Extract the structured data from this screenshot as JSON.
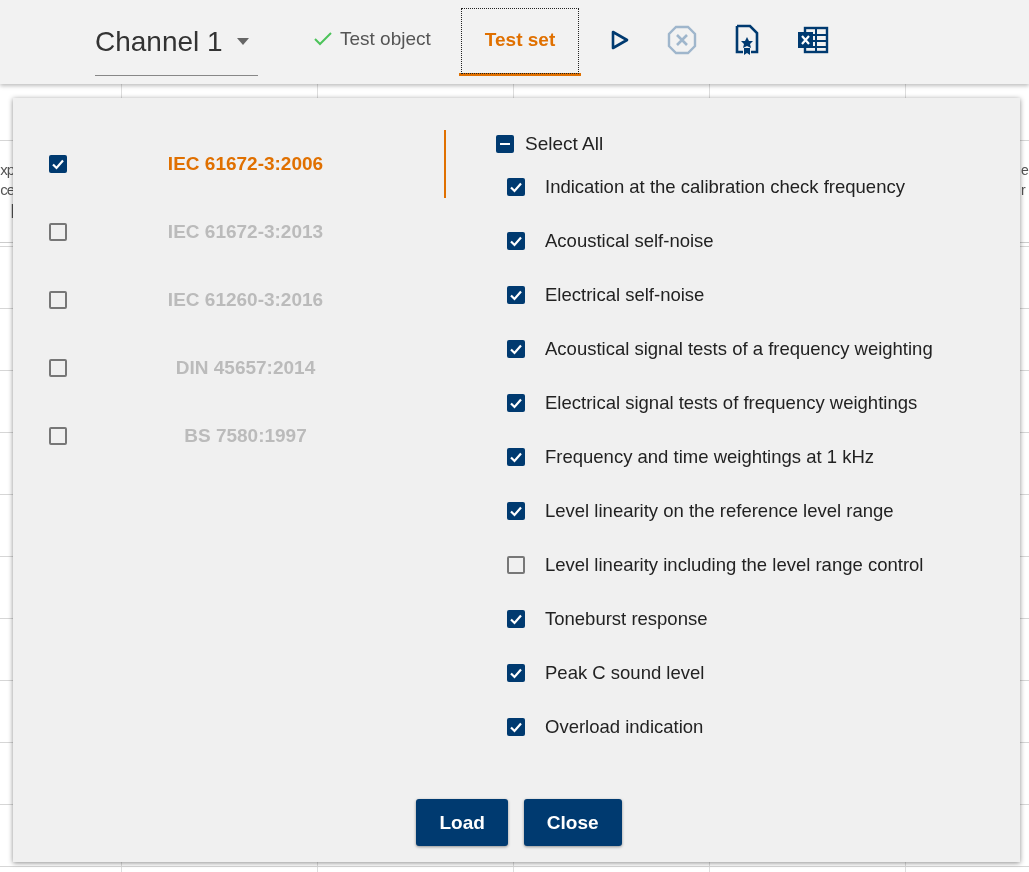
{
  "toolbar": {
    "channel": {
      "label": "Channel 1"
    },
    "tabs": [
      {
        "label": "Test object",
        "done": true,
        "selected": false
      },
      {
        "label": "Test set",
        "done": false,
        "selected": true
      }
    ],
    "actions": [
      {
        "kind": "play",
        "disabled": false
      },
      {
        "kind": "cancel",
        "disabled": true
      },
      {
        "kind": "certificate",
        "disabled": false
      },
      {
        "kind": "excel",
        "disabled": false
      }
    ]
  },
  "background_table": {
    "left_header_fragment": [
      "xp",
      "ce",
      "["
    ],
    "right_header_fragment": [
      "e",
      "r"
    ]
  },
  "dialog": {
    "standards": [
      {
        "label": "IEC 61672-3:2006",
        "selected": true,
        "checked": true
      },
      {
        "label": "IEC 61672-3:2013",
        "selected": false,
        "checked": false
      },
      {
        "label": "IEC 61260-3:2016",
        "selected": false,
        "checked": false
      },
      {
        "label": "DIN 45657:2014",
        "selected": false,
        "checked": false
      },
      {
        "label": "BS 7580:1997",
        "selected": false,
        "checked": false
      }
    ],
    "select_all": {
      "label": "Select All",
      "indeterminate": true
    },
    "tests": [
      {
        "label": "Indication at the calibration check frequency",
        "checked": true
      },
      {
        "label": "Acoustical self-noise",
        "checked": true
      },
      {
        "label": "Electrical self-noise",
        "checked": true
      },
      {
        "label": "Acoustical signal tests of a frequency weighting",
        "checked": true
      },
      {
        "label": "Electrical signal tests of frequency weightings",
        "checked": true
      },
      {
        "label": "Frequency and time weightings at 1 kHz",
        "checked": true
      },
      {
        "label": "Level linearity on the reference level range",
        "checked": true
      },
      {
        "label": "Level linearity including the level range control",
        "checked": false
      },
      {
        "label": "Toneburst response",
        "checked": true
      },
      {
        "label": "Peak C sound level",
        "checked": true
      },
      {
        "label": "Overload indication",
        "checked": true
      }
    ],
    "buttons": [
      "Load",
      "Close"
    ]
  }
}
